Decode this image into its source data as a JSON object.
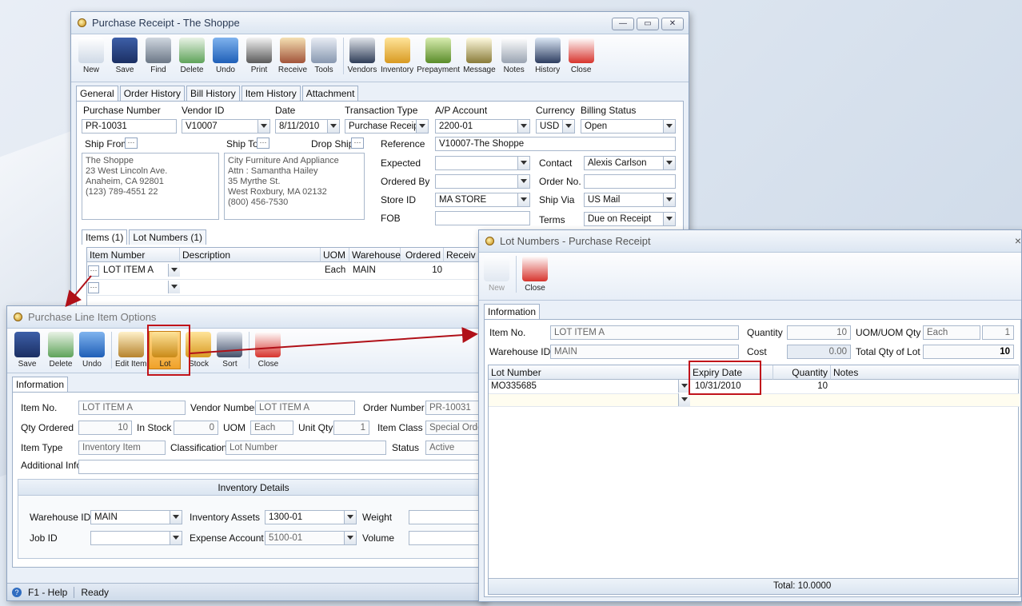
{
  "main_window": {
    "title": "Purchase Receipt - The Shoppe",
    "toolbar": [
      "New",
      "Save",
      "Find",
      "Delete",
      "Undo",
      "Print",
      "Receive",
      "Tools",
      "Vendors",
      "Inventory",
      "Prepayment",
      "Message",
      "Notes",
      "History",
      "Close"
    ],
    "tabs": [
      "General",
      "Order History",
      "Bill History",
      "Item History",
      "Attachment"
    ],
    "labels": {
      "purchase_number": "Purchase Number",
      "vendor_id": "Vendor ID",
      "date": "Date",
      "transaction_type": "Transaction Type",
      "ap_account": "A/P Account",
      "currency": "Currency",
      "billing_status": "Billing Status",
      "ship_from": "Ship From",
      "ship_to": "Ship To",
      "drop_ship": "Drop Ship",
      "reference": "Reference",
      "expected": "Expected",
      "contact": "Contact",
      "ordered_by": "Ordered By",
      "order_no": "Order No.",
      "store_id": "Store ID",
      "ship_via": "Ship Via",
      "fob": "FOB",
      "terms": "Terms"
    },
    "values": {
      "purchase_number": "PR-10031",
      "vendor_id": "V10007",
      "date": "8/11/2010",
      "transaction_type": "Purchase Receipt",
      "ap_account": "2200-01",
      "currency": "USD",
      "billing_status": "Open",
      "reference": "V10007-The Shoppe",
      "expected": "",
      "contact": "Alexis Carlson",
      "ordered_by": "",
      "order_no": "",
      "store_id": "MA STORE",
      "ship_via": "US Mail",
      "fob": "",
      "terms": "Due on Receipt"
    },
    "ship_from_address": "The Shoppe\n23 West Lincoln Ave.\nAnaheim, CA 92801\n(123) 789-4551 22",
    "ship_to_address": "City Furniture And Appliance\nAttn : Samantha Hailey\n35 Myrthe St.\nWest Roxbury, MA 02132\n(800) 456-7530",
    "item_tabs": [
      "Items (1)",
      "Lot Numbers (1)"
    ],
    "items_grid": {
      "columns": [
        "Item Number",
        "Description",
        "UOM",
        "Warehouse",
        "Ordered",
        "Receiv"
      ],
      "rows": [
        {
          "item_number": "LOT ITEM A",
          "description": "",
          "uom": "Each",
          "warehouse": "MAIN",
          "ordered": "10"
        }
      ]
    }
  },
  "line_window": {
    "title": "Purchase Line Item Options",
    "toolbar": [
      "Save",
      "Delete",
      "Undo",
      "Edit Item",
      "Lot",
      "Stock",
      "Sort",
      "Close"
    ],
    "tabs": [
      "Information"
    ],
    "labels": {
      "item_no": "Item No.",
      "vendor_number": "Vendor Number",
      "order_number": "Order Number",
      "qty_ordered": "Qty Ordered",
      "in_stock": "In Stock",
      "uom": "UOM",
      "unit_qty": "Unit Qty",
      "item_class": "Item Class",
      "item_type": "Item Type",
      "classification": "Classification",
      "status": "Status",
      "additional_info": "Additional Info",
      "inventory_details": "Inventory Details",
      "warehouse_id": "Warehouse ID",
      "inventory_assets": "Inventory Assets",
      "weight": "Weight",
      "job_id": "Job ID",
      "expense_account": "Expense Account",
      "volume": "Volume"
    },
    "values": {
      "item_no": "LOT ITEM A",
      "vendor_number": "LOT ITEM A",
      "order_number": "PR-10031",
      "qty_ordered": "10",
      "in_stock": "0",
      "uom": "Each",
      "unit_qty": "1",
      "item_class": "Special Order",
      "item_type": "Inventory Item",
      "classification": "Lot Number",
      "status": "Active",
      "additional_info": "",
      "warehouse_id": "MAIN",
      "inventory_assets": "1300-01",
      "weight": "",
      "job_id": "",
      "expense_account": "5100-01",
      "volume": ""
    },
    "status": {
      "help": "F1 - Help",
      "state": "Ready"
    }
  },
  "lot_window": {
    "title": "Lot Numbers - Purchase Receipt",
    "close_glyph": "×",
    "toolbar": [
      "New",
      "Close"
    ],
    "tabs": [
      "Information"
    ],
    "labels": {
      "item_no": "Item No.",
      "quantity": "Quantity",
      "uom_qty": "UOM/UOM Qty",
      "warehouse_id": "Warehouse ID",
      "cost": "Cost",
      "total_qty": "Total Qty of Lot"
    },
    "values": {
      "item_no": "LOT ITEM A",
      "quantity": "10",
      "uom": "Each",
      "uom_qty": "1",
      "warehouse_id": "MAIN",
      "cost": "0.00",
      "total_qty": "10"
    },
    "grid": {
      "columns": [
        "Lot Number",
        "Expiry Date",
        "Quantity",
        "Notes"
      ],
      "rows": [
        {
          "lot_number": "MO335685",
          "expiry_date": "10/31/2010",
          "quantity": "10",
          "notes": ""
        }
      ]
    },
    "total": "Total: 10.0000"
  },
  "colors": {
    "highlight": "#c0121a",
    "active_button": "#f0a22a"
  }
}
